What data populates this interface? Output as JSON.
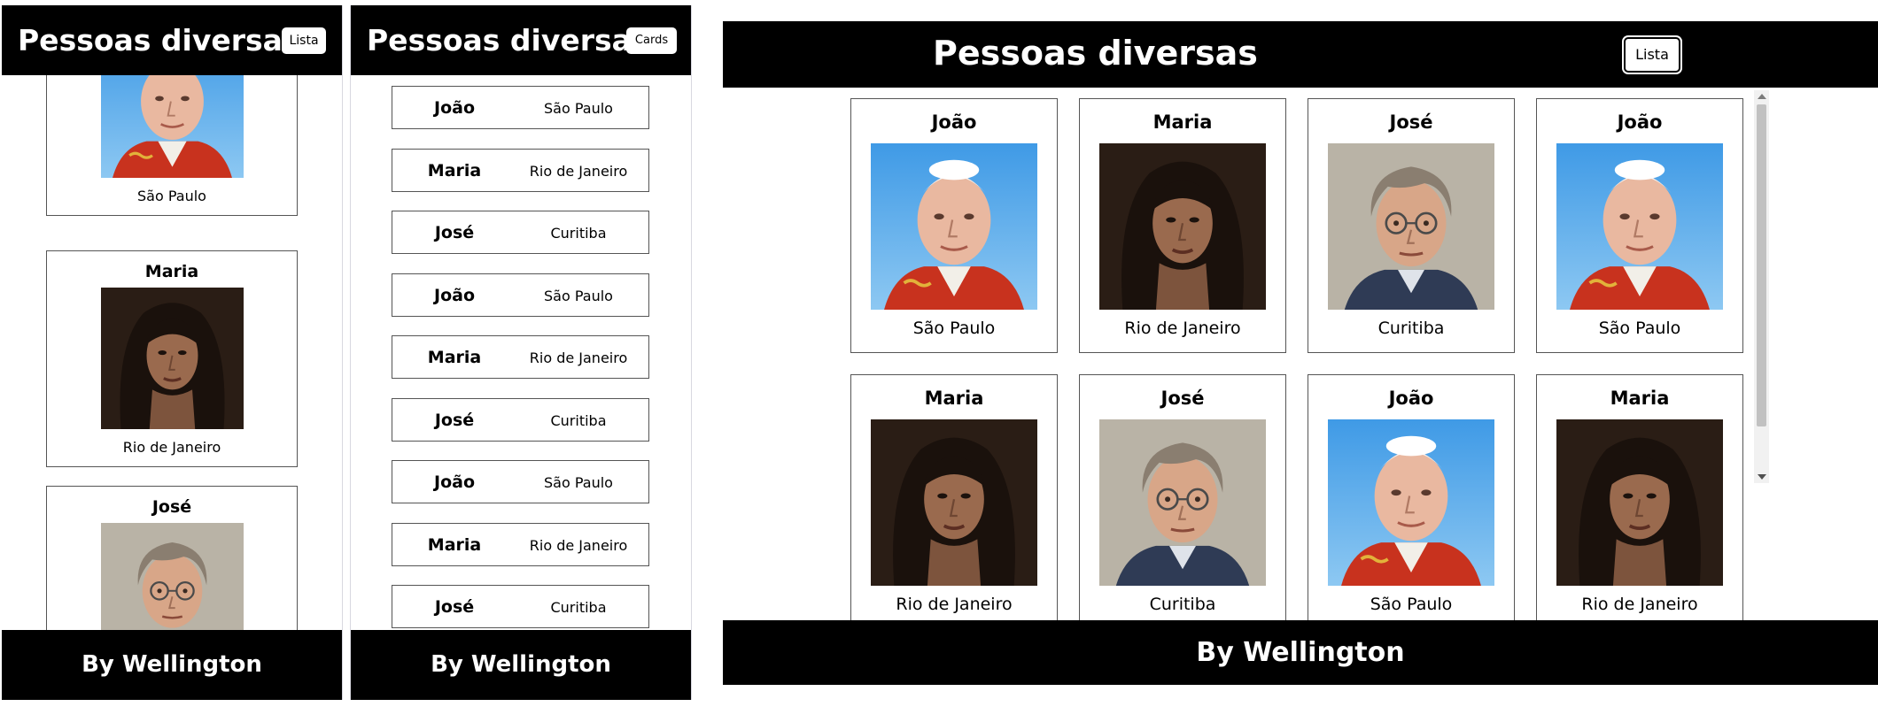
{
  "app": {
    "title": "Pessoas diversas",
    "footer": "By Wellington"
  },
  "panels": {
    "mobile_cards": {
      "toggle_label": "Lista"
    },
    "mobile_list": {
      "toggle_label": "Cards"
    },
    "desktop_cards": {
      "toggle_label": "Lista"
    }
  },
  "people": [
    {
      "name": "João",
      "city": "São Paulo",
      "photo": "portrait-elderly-man-white-cap"
    },
    {
      "name": "Maria",
      "city": "Rio de Janeiro",
      "photo": "portrait-woman-dark-hair"
    },
    {
      "name": "José",
      "city": "Curitiba",
      "photo": "portrait-man-glasses"
    }
  ],
  "mobile_cards": [
    {
      "name": "",
      "city": "São Paulo"
    },
    {
      "name": "Maria",
      "city": "Rio de Janeiro"
    },
    {
      "name": "José",
      "city": ""
    }
  ],
  "list_rows": [
    {
      "name": "João",
      "city": "São Paulo"
    },
    {
      "name": "Maria",
      "city": "Rio de Janeiro"
    },
    {
      "name": "José",
      "city": "Curitiba"
    },
    {
      "name": "João",
      "city": "São Paulo"
    },
    {
      "name": "Maria",
      "city": "Rio de Janeiro"
    },
    {
      "name": "José",
      "city": "Curitiba"
    },
    {
      "name": "João",
      "city": "São Paulo"
    },
    {
      "name": "Maria",
      "city": "Rio de Janeiro"
    },
    {
      "name": "José",
      "city": "Curitiba"
    }
  ],
  "grid_cards": [
    {
      "name": "João",
      "city": "São Paulo"
    },
    {
      "name": "Maria",
      "city": "Rio de Janeiro"
    },
    {
      "name": "José",
      "city": "Curitiba"
    },
    {
      "name": "João",
      "city": "São Paulo"
    },
    {
      "name": "Maria",
      "city": "Rio de Janeiro"
    },
    {
      "name": "José",
      "city": "Curitiba"
    },
    {
      "name": "João",
      "city": "São Paulo"
    },
    {
      "name": "Maria",
      "city": "Rio de Janeiro"
    }
  ],
  "colors": {
    "header_bg": "#000000",
    "header_text": "#ffffff",
    "card_border": "#555555"
  }
}
